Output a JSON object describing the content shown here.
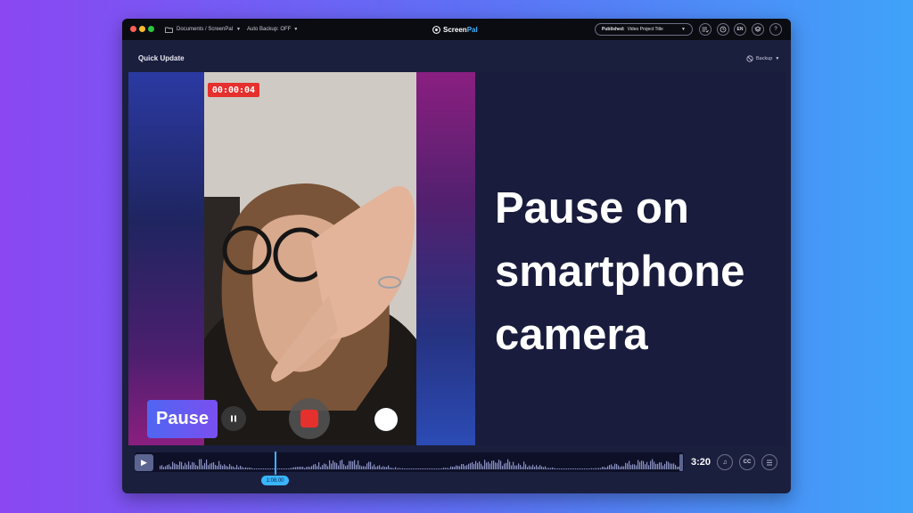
{
  "titlebar": {
    "breadcrumb": "Documents / ScreenPal",
    "auto_backup": "Auto Backup: OFF",
    "logo_part1": "Screen",
    "logo_part2": "Pal",
    "published_prefix": "Published:",
    "published_title": "Video Project Title",
    "lang": "EN",
    "help": "?"
  },
  "header": {
    "title": "Quick Update",
    "backup": "Backup"
  },
  "video": {
    "timer": "00:00:04",
    "pause_label": "Pause",
    "headline_lines": [
      "Pause on",
      "smartphone",
      "camera"
    ]
  },
  "timeline": {
    "playhead_time": "1:08.00",
    "duration": "3:20",
    "cc": "CC"
  },
  "colors": {
    "accent": "#39b5ff",
    "record": "#e5302e",
    "window_bg": "#1b1f3e"
  }
}
